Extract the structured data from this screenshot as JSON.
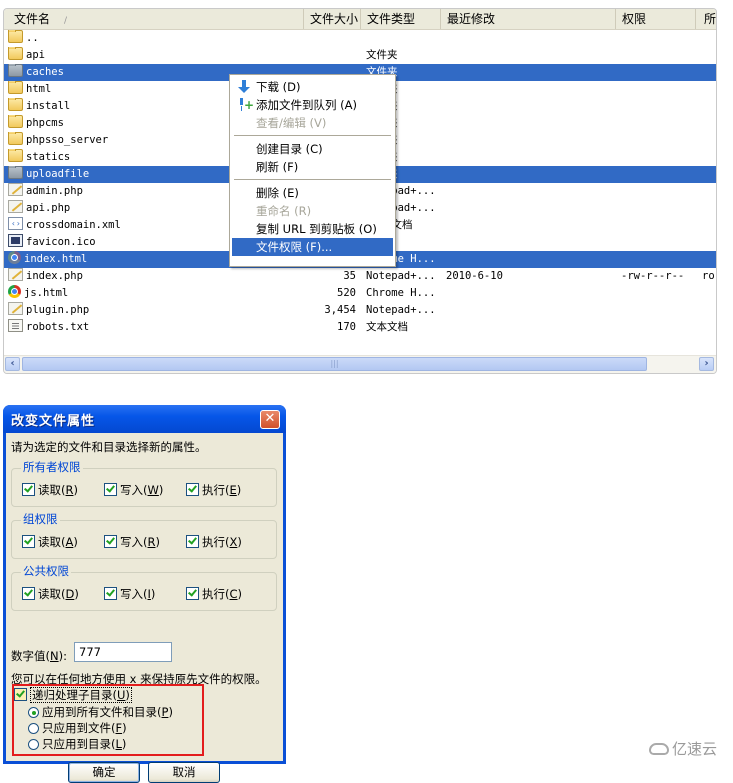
{
  "file_list": {
    "columns": {
      "name": "文件名",
      "size": "文件大小",
      "type": "文件类型",
      "modified": "最近修改",
      "permissions": "权限",
      "owner": "所"
    },
    "sort_indicator": "/",
    "rows": [
      {
        "icon": "folder",
        "name": "..",
        "size": "",
        "type": "",
        "modified": "",
        "permissions": "",
        "owner": "",
        "selected": false
      },
      {
        "icon": "folder",
        "name": "api",
        "size": "",
        "type": "文件夹",
        "modified": "",
        "permissions": "",
        "owner": "",
        "selected": false
      },
      {
        "icon": "folder-grey",
        "name": "caches",
        "size": "",
        "type": "文件夹",
        "modified": "",
        "permissions": "",
        "owner": "",
        "selected": true
      },
      {
        "icon": "folder",
        "name": "html",
        "size": "",
        "type": "文件夹",
        "modified": "",
        "permissions": "",
        "owner": "",
        "selected": false
      },
      {
        "icon": "folder",
        "name": "install",
        "size": "",
        "type": "文件夹",
        "modified": "",
        "permissions": "",
        "owner": "",
        "selected": false
      },
      {
        "icon": "folder",
        "name": "phpcms",
        "size": "",
        "type": "文件夹",
        "modified": "",
        "permissions": "",
        "owner": "",
        "selected": false
      },
      {
        "icon": "folder",
        "name": "phpsso_server",
        "size": "",
        "type": "文件夹",
        "modified": "",
        "permissions": "",
        "owner": "",
        "selected": false
      },
      {
        "icon": "folder",
        "name": "statics",
        "size": "",
        "type": "文件夹",
        "modified": "",
        "permissions": "",
        "owner": "",
        "selected": false
      },
      {
        "icon": "folder-grey",
        "name": "uploadfile",
        "size": "",
        "type": "文件夹",
        "modified": "",
        "permissions": "",
        "owner": "",
        "selected": true
      },
      {
        "icon": "php-file",
        "name": "admin.php",
        "size": "",
        "type": "Notepad+...",
        "modified": "",
        "permissions": "",
        "owner": "",
        "selected": false
      },
      {
        "icon": "php-file",
        "name": "api.php",
        "size": "",
        "type": "Notepad+...",
        "modified": "",
        "permissions": "",
        "owner": "",
        "selected": false
      },
      {
        "icon": "xml-file",
        "name": "crossdomain.xml",
        "size": "",
        "type": "XML 文档",
        "modified": "",
        "permissions": "",
        "owner": "",
        "selected": false
      },
      {
        "icon": "ico-file",
        "name": "favicon.ico",
        "size": "",
        "type": "",
        "modified": "",
        "permissions": "",
        "owner": "",
        "selected": false
      },
      {
        "icon": "chrome-file-dim",
        "name": "index.html",
        "size": "",
        "type": "Chrome H...",
        "modified": "",
        "permissions": "",
        "owner": "",
        "selected": true
      },
      {
        "icon": "php-file",
        "name": "index.php",
        "size": "35",
        "type": "Notepad+...",
        "modified": "2010-6-10",
        "permissions": "-rw-r--r--",
        "owner": "ro",
        "selected": false
      },
      {
        "icon": "chrome-file",
        "name": "js.html",
        "size": "520",
        "type": "Chrome H...",
        "modified": "",
        "permissions": "",
        "owner": "",
        "selected": false
      },
      {
        "icon": "php-file",
        "name": "plugin.php",
        "size": "3,454",
        "type": "Notepad+...",
        "modified": "",
        "permissions": "",
        "owner": "",
        "selected": false
      },
      {
        "icon": "txt-file",
        "name": "robots.txt",
        "size": "170",
        "type": "文本文档",
        "modified": "",
        "permissions": "",
        "owner": "",
        "selected": false
      }
    ],
    "scrollbar": {
      "left_arrow": "‹",
      "right_arrow": "›",
      "grip": "|||"
    }
  },
  "context_menu": {
    "items": [
      {
        "label": "下载 (D)",
        "icon": "download-arrow",
        "disabled": false,
        "highlighted": false
      },
      {
        "label": "添加文件到队列 (A)",
        "icon": "add-to-queue",
        "disabled": false,
        "highlighted": false
      },
      {
        "label": "查看/编辑 (V)",
        "icon": "",
        "disabled": true,
        "highlighted": false
      },
      {
        "separator": true
      },
      {
        "label": "创建目录 (C)",
        "icon": "",
        "disabled": false,
        "highlighted": false
      },
      {
        "label": "刷新 (F)",
        "icon": "",
        "disabled": false,
        "highlighted": false
      },
      {
        "separator": true
      },
      {
        "label": "删除 (E)",
        "icon": "",
        "disabled": false,
        "highlighted": false
      },
      {
        "label": "重命名 (R)",
        "icon": "",
        "disabled": true,
        "highlighted": false
      },
      {
        "label": "复制 URL 到剪贴板 (O)",
        "icon": "",
        "disabled": false,
        "highlighted": false
      },
      {
        "label": "文件权限 (F)...",
        "icon": "",
        "disabled": false,
        "highlighted": true
      }
    ]
  },
  "dialog": {
    "title": "改变文件属性",
    "close_glyph": "✕",
    "intro": "请为选定的文件和目录选择新的属性。",
    "groups": [
      {
        "label": "所有者权限",
        "options": [
          {
            "text": "读取",
            "key": "R",
            "checked": true
          },
          {
            "text": "写入",
            "key": "W",
            "checked": true
          },
          {
            "text": "执行",
            "key": "E",
            "checked": true
          }
        ]
      },
      {
        "label": "组权限",
        "options": [
          {
            "text": "读取",
            "key": "A",
            "checked": true
          },
          {
            "text": "写入",
            "key": "R",
            "checked": true
          },
          {
            "text": "执行",
            "key": "X",
            "checked": true
          }
        ]
      },
      {
        "label": "公共权限",
        "options": [
          {
            "text": "读取",
            "key": "D",
            "checked": true
          },
          {
            "text": "写入",
            "key": "I",
            "checked": true
          },
          {
            "text": "执行",
            "key": "C",
            "checked": true
          }
        ]
      }
    ],
    "numeric": {
      "label": "数字值",
      "key": "N",
      "value": "777"
    },
    "note": "您可以在任何地方使用 x 来保持原先文件的权限。",
    "recurse": {
      "label": "递归处理子目录",
      "key": "U",
      "checked": true
    },
    "apply_options": [
      {
        "label": "应用到所有文件和目录",
        "key": "P",
        "selected": true
      },
      {
        "label": "只应用到文件",
        "key": "F",
        "selected": false
      },
      {
        "label": "只应用到目录",
        "key": "L",
        "selected": false
      }
    ],
    "buttons": {
      "ok": "确定",
      "cancel": "取消"
    }
  },
  "watermark": {
    "text": "亿速云"
  }
}
